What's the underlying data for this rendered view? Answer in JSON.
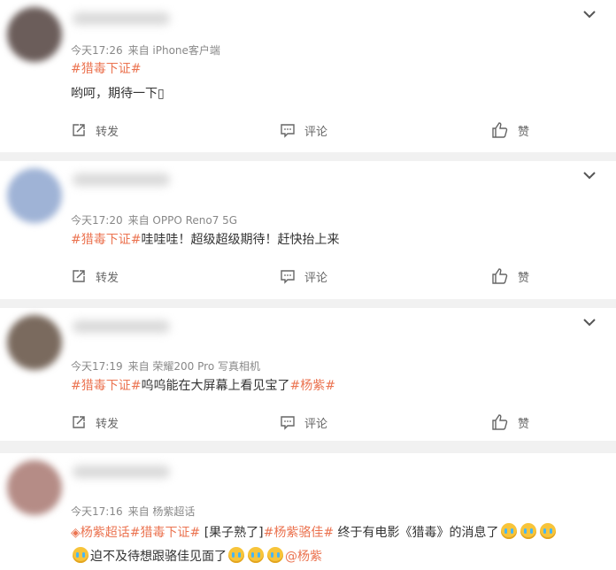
{
  "comments": [
    {
      "time": "今天17:26",
      "source": "来自 iPhone客户端",
      "line1": [
        {
          "text": "#猎毒下证#",
          "topic": true
        }
      ],
      "line2": [
        {
          "text": "哟呵，期待一下▯",
          "topic": false
        }
      ],
      "actions": {
        "repost": "转发",
        "comment": "评论",
        "like": "赞"
      },
      "avatar_color": "#6b5d5a"
    },
    {
      "time": "今天17:20",
      "source": "来自 OPPO Reno7 5G",
      "line1": [
        {
          "text": "#猎毒下证#",
          "topic": true
        },
        {
          "text": "哇哇哇！超级超级期待！赶快抬上来",
          "topic": false
        }
      ],
      "actions": {
        "repost": "转发",
        "comment": "评论",
        "like": "赞"
      },
      "avatar_color": "#9fb3d6"
    },
    {
      "time": "今天17:19",
      "source": "来自 荣耀200 Pro 写真相机",
      "line1": [
        {
          "text": "#猎毒下证#",
          "topic": true
        },
        {
          "text": "呜呜能在大屏幕上看见宝了",
          "topic": false
        },
        {
          "text": "#杨紫#",
          "topic": true
        }
      ],
      "actions": {
        "repost": "转发",
        "comment": "评论",
        "like": "赞"
      },
      "avatar_color": "#7a6a5e"
    },
    {
      "time": "今天17:16",
      "source": "来自 杨紫超话",
      "line1": [
        {
          "text": "◈杨紫超话",
          "topic": true
        },
        {
          "text": "#猎毒下证#",
          "topic": true
        },
        {
          "text": " [果子熟了]",
          "topic": false
        },
        {
          "text": "#杨紫骆佳#",
          "topic": true
        },
        {
          "text": " 终于有电影《猎毒》的消息了",
          "topic": false
        }
      ],
      "line1_emoji": 3,
      "line2_lead_emoji": 1,
      "line2": [
        {
          "text": "迫不及待想跟骆佳见面了",
          "topic": false
        }
      ],
      "line2_trail_emoji": 3,
      "line2_mention": "@杨紫",
      "avatar_color": "#b58c86"
    }
  ],
  "icons": {
    "menu": "chevron-down-icon",
    "repost": "repost-icon",
    "comment": "comment-icon",
    "like": "thumbs-up-icon",
    "emoji": "crying-face-emoji"
  },
  "colors": {
    "topic": "#eb7350",
    "meta": "#888888",
    "background": "#f1f1f1"
  }
}
